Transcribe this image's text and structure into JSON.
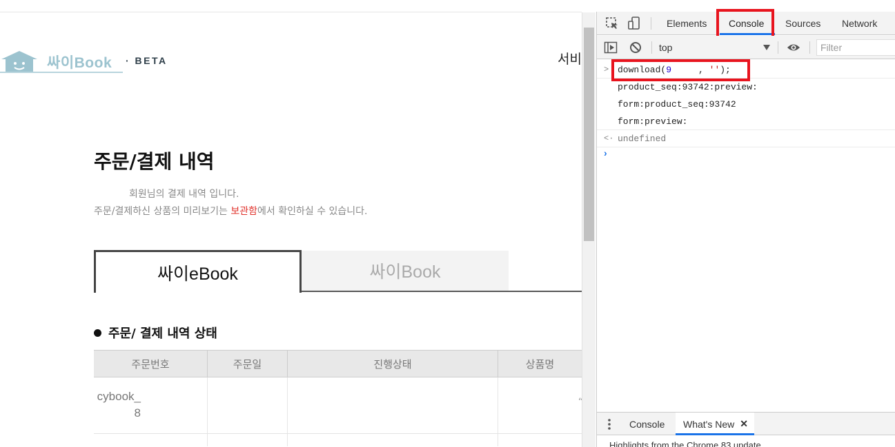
{
  "site": {
    "logo_text": "싸이Book",
    "logo_beta": "· BETA",
    "header_right": "서비"
  },
  "main": {
    "title": "주문/결제 내역",
    "desc_line1": "회원님의 결제 내역 입니다.",
    "desc_line2_before": "주문/결제하신 상품의 미리보기는 ",
    "desc_line2_link": "보관함",
    "desc_line2_after": "에서 확인하실 수 있습니다.",
    "tabs": [
      {
        "label": "싸이eBook",
        "active": true
      },
      {
        "label": "싸이Book",
        "active": false
      }
    ],
    "section_title": "주문/ 결제 내역 상태",
    "table": {
      "headers": [
        "주문번호",
        "주문일",
        "진행상태",
        "상품명"
      ],
      "rows": [
        {
          "order_no_line1": "cybook_",
          "order_no_line2": "8",
          "product": "“"
        }
      ]
    }
  },
  "devtools": {
    "tabs": [
      "Elements",
      "Console",
      "Sources",
      "Network"
    ],
    "active_tab": "Console",
    "context": "top",
    "filter_placeholder": "Filter",
    "console_lines": [
      {
        "type": "input",
        "call": "download(",
        "num": "9",
        "gap": "     , ",
        "str": "''",
        "end": ");"
      },
      {
        "type": "log",
        "text": "product_seq:93742:preview:"
      },
      {
        "type": "log",
        "text": "form:product_seq:93742"
      },
      {
        "type": "log",
        "text": "form:preview:"
      },
      {
        "type": "result",
        "text": "undefined"
      }
    ],
    "drawer": {
      "tabs": [
        "Console",
        "What's New"
      ],
      "active_tab": "What's New",
      "content": "Highlights from the Chrome 83 update"
    }
  },
  "colors": {
    "highlight_box": "#e8141e",
    "devtools_accent": "#1a73e8",
    "logo_blue": "#9cc3cf",
    "link_red": "#e0302a"
  }
}
